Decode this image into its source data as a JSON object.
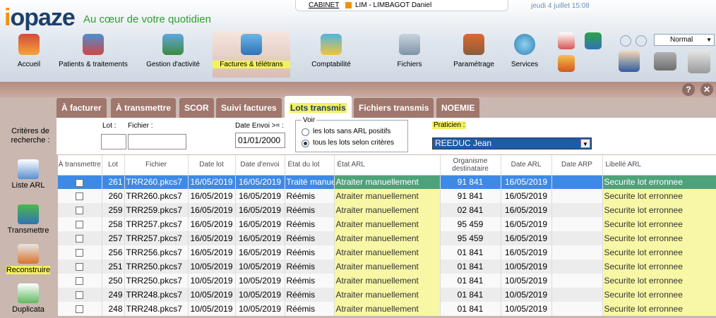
{
  "app": {
    "logo": "iopaze",
    "tagline": "Au cœur de votre quotidien"
  },
  "session": {
    "cabinet": "CABINET",
    "user": "LIM - LIMBAGOT Daniel",
    "datetime": "jeudi 4 juillet 15:08"
  },
  "nav": {
    "items": [
      {
        "label": "Accueil",
        "icon": "home-icon"
      },
      {
        "label": "Patients & traitements",
        "icon": "patients-icon"
      },
      {
        "label": "Gestion d'activité",
        "icon": "activity-icon"
      },
      {
        "label": "Factures & télétrans",
        "icon": "invoices-icon"
      },
      {
        "label": "Comptabilité",
        "icon": "calculator-icon"
      },
      {
        "label": "Fichiers",
        "icon": "database-icon"
      },
      {
        "label": "Paramétrage",
        "icon": "gears-icon"
      },
      {
        "label": "Services",
        "icon": "globe-icon"
      }
    ],
    "zoom_value": "Normal"
  },
  "help": {
    "help_label": "?",
    "close_label": "✕"
  },
  "tabs": [
    "À facturer",
    "À transmettre",
    "SCOR",
    "Suivi factures",
    "Lots transmis",
    "Fichiers transmis",
    "NOEMIE"
  ],
  "criteria": {
    "title": "Critères de recherche :",
    "lot_label": "Lot :",
    "fichier_label": "Fichier :",
    "date_envoi_label": "Date Envoi >= :",
    "date_envoi_value": "01/01/2000",
    "voir_label": "Voir",
    "radio1": "les lots sans ARL positifs",
    "radio2": "tous les lots selon critères",
    "praticien_label": "Praticien :",
    "praticien_value": "REEDUC Jean"
  },
  "sidebar": [
    {
      "label": "Liste ARL",
      "icon": "list-arl-icon"
    },
    {
      "label": "Transmettre",
      "icon": "transmit-icon"
    },
    {
      "label": "Reconstruire",
      "icon": "rebuild-icon"
    },
    {
      "label": "Duplicata",
      "icon": "duplicate-icon"
    }
  ],
  "table": {
    "headers": [
      "À transmettre",
      "Lot",
      "Fichier",
      "Date lot",
      "Date d'envoi",
      "État du lot",
      "État ARL",
      "Organisme destinataire",
      "Date ARL",
      "Date ARP",
      "Libellé ARL"
    ],
    "rows": [
      [
        "",
        "261",
        "TRR260.pkcs7",
        "16/05/2019",
        "16/05/2019",
        "Traité manuellement",
        "Atraiter manuellement",
        "91 841",
        "16/05/2019",
        "",
        "Securite lot erronnee"
      ],
      [
        "",
        "260",
        "TRR260.pkcs7",
        "16/05/2019",
        "16/05/2019",
        "Réémis",
        "Atraiter manuellement",
        "91 841",
        "16/05/2019",
        "",
        "Securite lot erronnee"
      ],
      [
        "",
        "259",
        "TRR259.pkcs7",
        "16/05/2019",
        "16/05/2019",
        "Réémis",
        "Atraiter manuellement",
        "02 841",
        "16/05/2019",
        "",
        "Securite lot erronnee"
      ],
      [
        "",
        "258",
        "TRR257.pkcs7",
        "16/05/2019",
        "16/05/2019",
        "Réémis",
        "Atraiter manuellement",
        "95 459",
        "16/05/2019",
        "",
        "Securite lot erronnee"
      ],
      [
        "",
        "257",
        "TRR257.pkcs7",
        "16/05/2019",
        "16/05/2019",
        "Réémis",
        "Atraiter manuellement",
        "95 459",
        "16/05/2019",
        "",
        "Securite lot erronnee"
      ],
      [
        "",
        "256",
        "TRR256.pkcs7",
        "16/05/2019",
        "16/05/2019",
        "Réémis",
        "Atraiter manuellement",
        "01 841",
        "16/05/2019",
        "",
        "Securite lot erronnee"
      ],
      [
        "",
        "251",
        "TRR250.pkcs7",
        "10/05/2019",
        "10/05/2019",
        "Réémis",
        "Atraiter manuellement",
        "01 841",
        "10/05/2019",
        "",
        "Securite lot erronnee"
      ],
      [
        "",
        "250",
        "TRR250.pkcs7",
        "10/05/2019",
        "10/05/2019",
        "Réémis",
        "Atraiter manuellement",
        "01 841",
        "10/05/2019",
        "",
        "Securite lot erronnee"
      ],
      [
        "",
        "249",
        "TRR248.pkcs7",
        "10/05/2019",
        "10/05/2019",
        "Réémis",
        "Atraiter manuellement",
        "01 841",
        "10/05/2019",
        "",
        "Securite lot erronnee"
      ],
      [
        "",
        "248",
        "TRR248.pkcs7",
        "10/05/2019",
        "10/05/2019",
        "Réémis",
        "Atraiter manuellement",
        "01 841",
        "10/05/2019",
        "",
        "Securite lot erronnee"
      ]
    ]
  },
  "colors": {
    "accent": "#f39200",
    "brand": "#1d3f6b",
    "highlight": "#f4f25a",
    "selection": "#3d8ae6",
    "tab": "#a0776d"
  }
}
